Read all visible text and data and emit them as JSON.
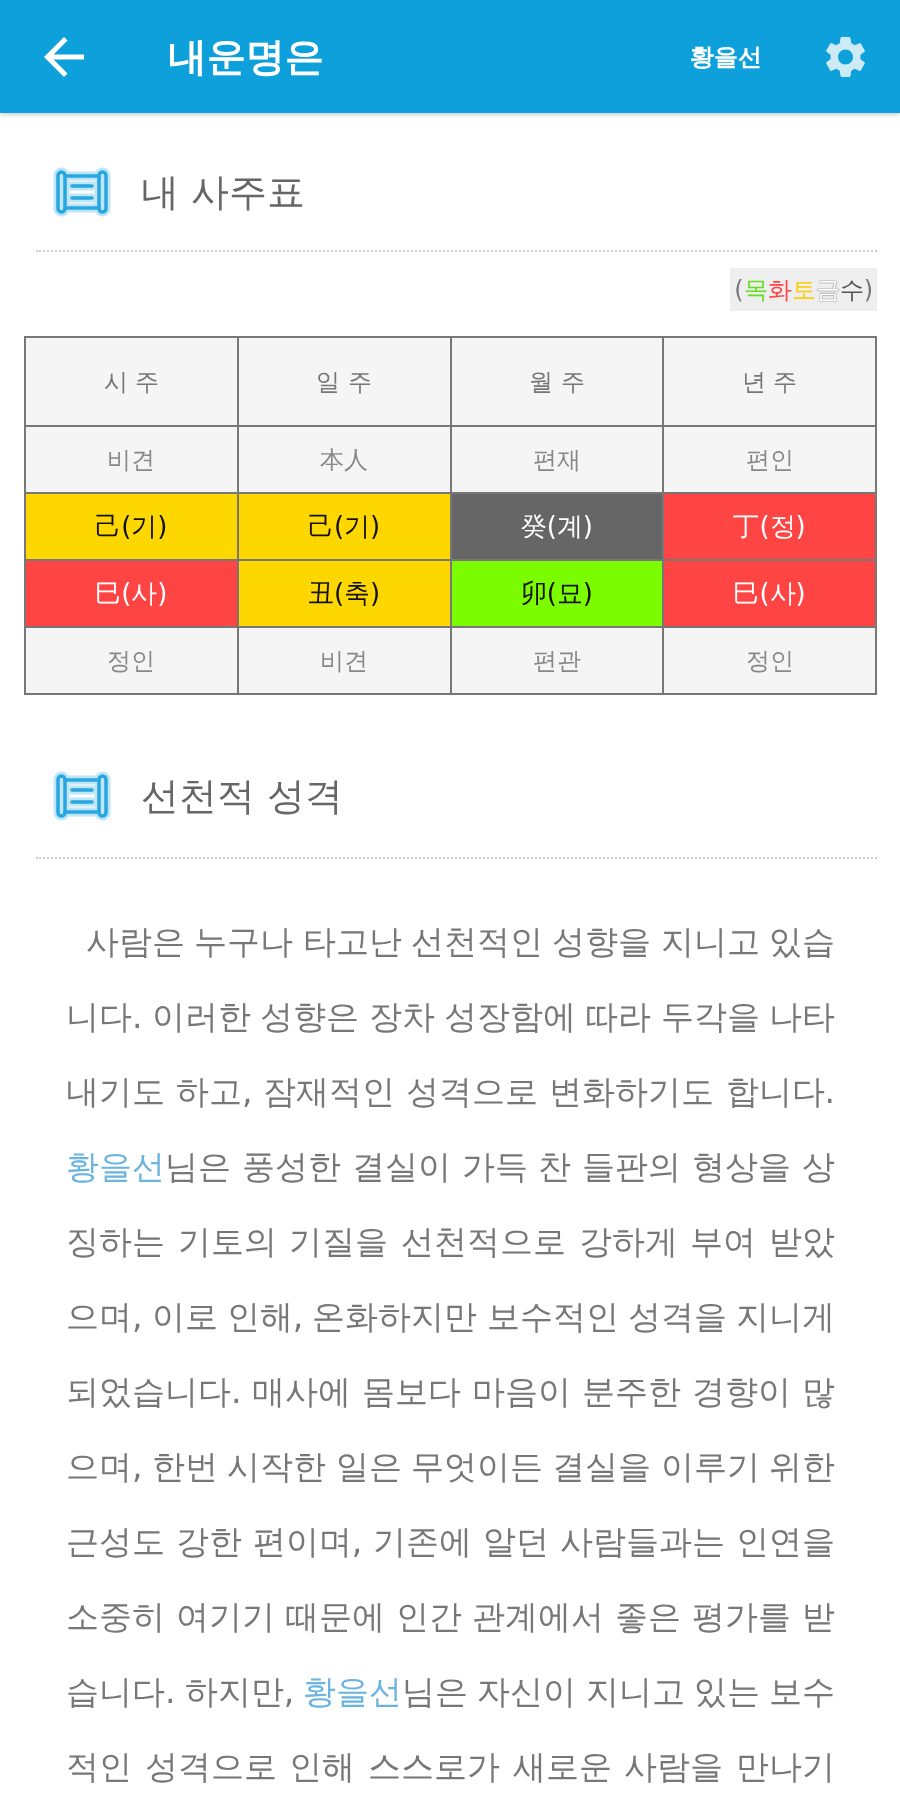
{
  "app_bar": {
    "title": "내운명은",
    "user_name": "황을선"
  },
  "sections": [
    {
      "kind": "table",
      "title": "내 사주표",
      "legend": {
        "open": "(",
        "elements": [
          {
            "label": "목",
            "color": "#66dd22"
          },
          {
            "label": "화",
            "color": "#ff4444"
          },
          {
            "label": "토",
            "color": "#ffcc00"
          },
          {
            "label": "금",
            "color": "#ffffff"
          },
          {
            "label": "수",
            "color": "#555555"
          }
        ],
        "close": ")"
      },
      "table": {
        "columns": [
          "시 주",
          "일 주",
          "월 주",
          "년 주"
        ],
        "rows": [
          {
            "kind": "plain",
            "cells": [
              {
                "text": "비견"
              },
              {
                "text": "本人"
              },
              {
                "text": "편재"
              },
              {
                "text": "편인"
              }
            ]
          },
          {
            "kind": "element",
            "cells": [
              {
                "text": "己(기)",
                "color": "#ffd700"
              },
              {
                "text": "己(기)",
                "color": "#ffd700"
              },
              {
                "text": "癸(계)",
                "color": "#666666"
              },
              {
                "text": "丁(정)",
                "color": "#ff4444"
              }
            ]
          },
          {
            "kind": "element",
            "cells": [
              {
                "text": "巳(사)",
                "color": "#ff4444"
              },
              {
                "text": "丑(축)",
                "color": "#ffd700"
              },
              {
                "text": "卯(묘)",
                "color": "#7cfc00"
              },
              {
                "text": "巳(사)",
                "color": "#ff4444"
              }
            ]
          },
          {
            "kind": "plain",
            "cells": [
              {
                "text": "정인"
              },
              {
                "text": "비견"
              },
              {
                "text": "편관"
              },
              {
                "text": "정인"
              }
            ]
          }
        ]
      }
    },
    {
      "kind": "text",
      "title": "선천적 성격",
      "paragraph": [
        {
          "kind": "plain",
          "text": "사람은 누구나 타고난 선천적인 성향을 지니고 있습니다. 이러한 성향은 장차 성장함에 따라 두각을 나타내기도 하고, 잠재적인 성격으로 변화하기도 합니다. "
        },
        {
          "kind": "name",
          "text": "황을선"
        },
        {
          "kind": "plain",
          "text": "님은 풍성한 결실이 가득 찬 들판의 형상을 상징하는 기토의 기질을 선천적으로 강하게 부여 받았으며, 이로 인해, 온화하지만 보수적인 성격을 지니게 되었습니다. 매사에 몸보다 마음이 분주한 경향이 많으며, 한번 시작한 일은 무엇이든 결실을 이루기 위한 근성도 강한 편이며, 기존에 알던 사람들과는 인연을 소중히 여기기 때문에 인간 관계에서 좋은 평가를 받습니다. 하지만, "
        },
        {
          "kind": "name",
          "text": "황을선"
        },
        {
          "kind": "plain",
          "text": "님은 자신이 지니고 있는 보수적인 성격으로 인해 스스로가 새로운 사람을 만나기"
        }
      ]
    }
  ]
}
